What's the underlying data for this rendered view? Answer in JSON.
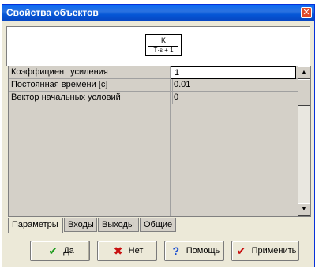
{
  "window": {
    "title": "Свойства объектов"
  },
  "formula": {
    "numerator": "K",
    "denominator": "T·s + 1"
  },
  "properties": [
    {
      "name": "Коэффициент усиления",
      "value": "1"
    },
    {
      "name": "Постоянная времени [c]",
      "value": "0.01"
    },
    {
      "name": "Вектор начальных условий",
      "value": "0"
    }
  ],
  "tabs": [
    "Параметры",
    "Входы",
    "Выходы",
    "Общие"
  ],
  "buttons": {
    "ok": "Да",
    "no": "Нет",
    "help": "Помощь",
    "apply": "Применить"
  },
  "icons": {
    "close": "close-icon",
    "ok": "checkmark-icon",
    "no": "cross-icon",
    "help": "question-icon",
    "apply": "checkmark-icon"
  },
  "colors": {
    "title_bar": "#0556d6",
    "dialog_bg": "#ece9d8",
    "ok_icon": "#1b9a1b",
    "cancel_icon": "#c81010",
    "help_icon": "#1248d0"
  }
}
